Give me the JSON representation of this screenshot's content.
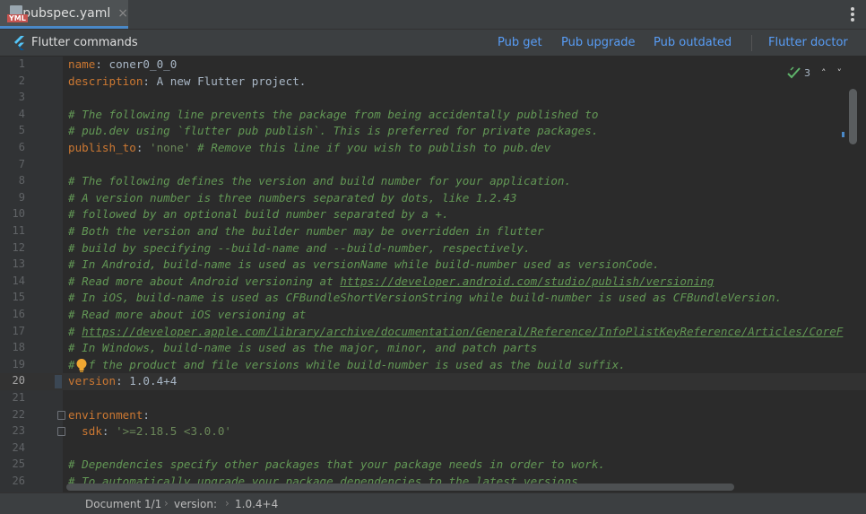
{
  "tab": {
    "label": "pubspec.yaml",
    "icon": "yml-file-icon",
    "badge": "YML",
    "close": "×"
  },
  "commands": {
    "title": "Flutter commands",
    "links": [
      "Pub get",
      "Pub upgrade",
      "Pub outdated",
      "Flutter doctor"
    ]
  },
  "inspection": {
    "count": "3"
  },
  "lines": [
    {
      "n": "1",
      "key": "name",
      "rest": " coner0_0_0"
    },
    {
      "n": "2",
      "key": "description",
      "rest": " A new Flutter project."
    },
    {
      "n": "3"
    },
    {
      "n": "4",
      "comment": "# The following line prevents the package from being accidentally published to"
    },
    {
      "n": "5",
      "comment": "# pub.dev using `flutter pub publish`. This is preferred for private packages."
    },
    {
      "n": "6",
      "key": "publish_to",
      "str": " 'none'",
      "trail": " # Remove this line if you wish to publish to pub.dev"
    },
    {
      "n": "7"
    },
    {
      "n": "8",
      "comment": "# The following defines the version and build number for your application."
    },
    {
      "n": "9",
      "comment": "# A version number is three numbers separated by dots, like 1.2.43"
    },
    {
      "n": "10",
      "comment": "# followed by an optional build number separated by a +."
    },
    {
      "n": "11",
      "comment": "# Both the version and the builder number may be overridden in flutter"
    },
    {
      "n": "12",
      "comment": "# build by specifying --build-name and --build-number, respectively."
    },
    {
      "n": "13",
      "comment": "# In Android, build-name is used as versionName while build-number used as versionCode."
    },
    {
      "n": "14",
      "comment": "# Read more about Android versioning at ",
      "link": "https://developer.android.com/studio/publish/versioning"
    },
    {
      "n": "15",
      "comment": "# In iOS, build-name is used as CFBundleShortVersionString while build-number is used as CFBundleVersion."
    },
    {
      "n": "16",
      "comment": "# Read more about iOS versioning at"
    },
    {
      "n": "17",
      "comment": "# ",
      "link": "https://developer.apple.com/library/archive/documentation/General/Reference/InfoPlistKeyReference/Articles/CoreF"
    },
    {
      "n": "18",
      "comment": "# In Windows, build-name is used as the major, minor, and patch parts"
    },
    {
      "n": "19",
      "comment": "#  f the product and file versions while build-number is used as the build suffix."
    },
    {
      "n": "20",
      "key": "version",
      "rest": " 1.0.4+4"
    },
    {
      "n": "21"
    },
    {
      "n": "22",
      "key": "environment",
      "rest": ""
    },
    {
      "n": "23",
      "key": "  sdk",
      "str": " '>=2.18.5 <3.0.0'"
    },
    {
      "n": "24"
    },
    {
      "n": "25",
      "comment": "# Dependencies specify other packages that your package needs in order to work."
    },
    {
      "n": "26",
      "comment": "# To automatically upgrade your package dependencies to the latest versions"
    }
  ],
  "breadcrumb": {
    "doc": "Document 1/1",
    "key": "version:",
    "value": "1.0.4+4"
  },
  "colors": {
    "accent": "#4a88c7",
    "link": "#589df6",
    "comment": "#629755",
    "key": "#cc7832",
    "string": "#6a8759"
  }
}
